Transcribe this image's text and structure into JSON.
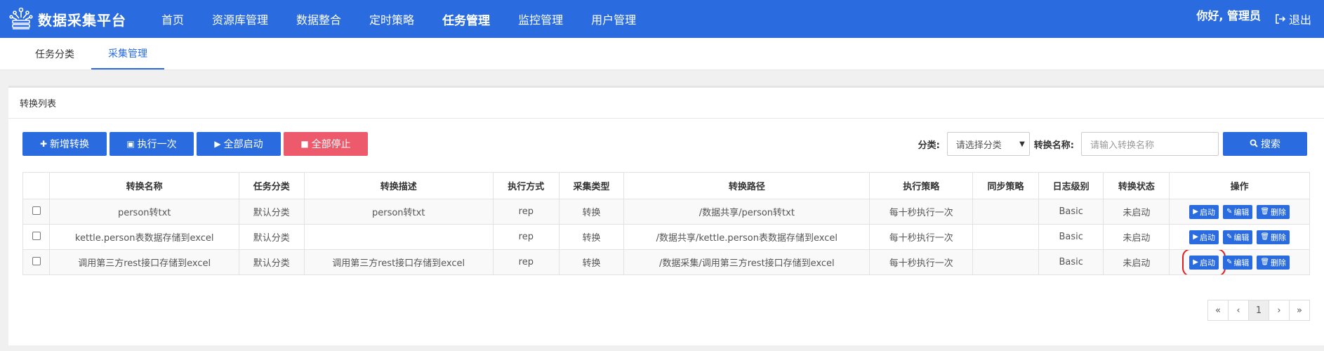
{
  "app": {
    "title": "数据采集平台",
    "logo_icon": "db-logo-icon",
    "accent": "#2a6ce0"
  },
  "nav": {
    "items": [
      {
        "label": "首页"
      },
      {
        "label": "资源库管理"
      },
      {
        "label": "数据整合"
      },
      {
        "label": "定时策略"
      },
      {
        "label": "任务管理"
      },
      {
        "label": "监控管理"
      },
      {
        "label": "用户管理"
      }
    ],
    "active_index": 4
  },
  "user": {
    "greeting": "你好, 管理员",
    "logout_label": "退出"
  },
  "subtabs": {
    "items": [
      {
        "label": "任务分类"
      },
      {
        "label": "采集管理"
      }
    ],
    "active_index": 1
  },
  "panel": {
    "title": "转换列表"
  },
  "toolbar": {
    "new_label": "新增转换",
    "exec_label": "执行一次",
    "start_all_label": "全部启动",
    "stop_all_label": "全部停止",
    "stop_color": "#ec5a6b"
  },
  "filters": {
    "category_label": "分类:",
    "category_selected": "请选择分类",
    "name_label": "转换名称:",
    "name_placeholder": "请输入转换名称",
    "search_label": "搜索"
  },
  "table": {
    "headers": [
      "转换名称",
      "任务分类",
      "转换描述",
      "执行方式",
      "采集类型",
      "转换路径",
      "执行策略",
      "同步策略",
      "日志级别",
      "转换状态",
      "操作"
    ],
    "rows": [
      {
        "name": "person转txt",
        "category": "默认分类",
        "desc": "person转txt",
        "exec_mode": "rep",
        "type": "转换",
        "path": "/数据共享/person转txt",
        "strategy": "每十秒执行一次",
        "sync": "",
        "log": "Basic",
        "status": "未启动"
      },
      {
        "name": "kettle.person表数据存储到excel",
        "category": "默认分类",
        "desc": "",
        "exec_mode": "rep",
        "type": "转换",
        "path": "/数据共享/kettle.person表数据存储到excel",
        "strategy": "每十秒执行一次",
        "sync": "",
        "log": "Basic",
        "status": "未启动"
      },
      {
        "name": "调用第三方rest接口存储到excel",
        "category": "默认分类",
        "desc": "调用第三方rest接口存储到excel",
        "exec_mode": "rep",
        "type": "转换",
        "path": "/数据采集/调用第三方rest接口存储到excel",
        "strategy": "每十秒执行一次",
        "sync": "",
        "log": "Basic",
        "status": "未启动"
      }
    ],
    "ops": {
      "start_label": "启动",
      "edit_label": "编辑",
      "delete_label": "删除"
    }
  },
  "pager": {
    "first": "«",
    "prev": "‹",
    "current": "1",
    "next": "›",
    "last": "»"
  }
}
